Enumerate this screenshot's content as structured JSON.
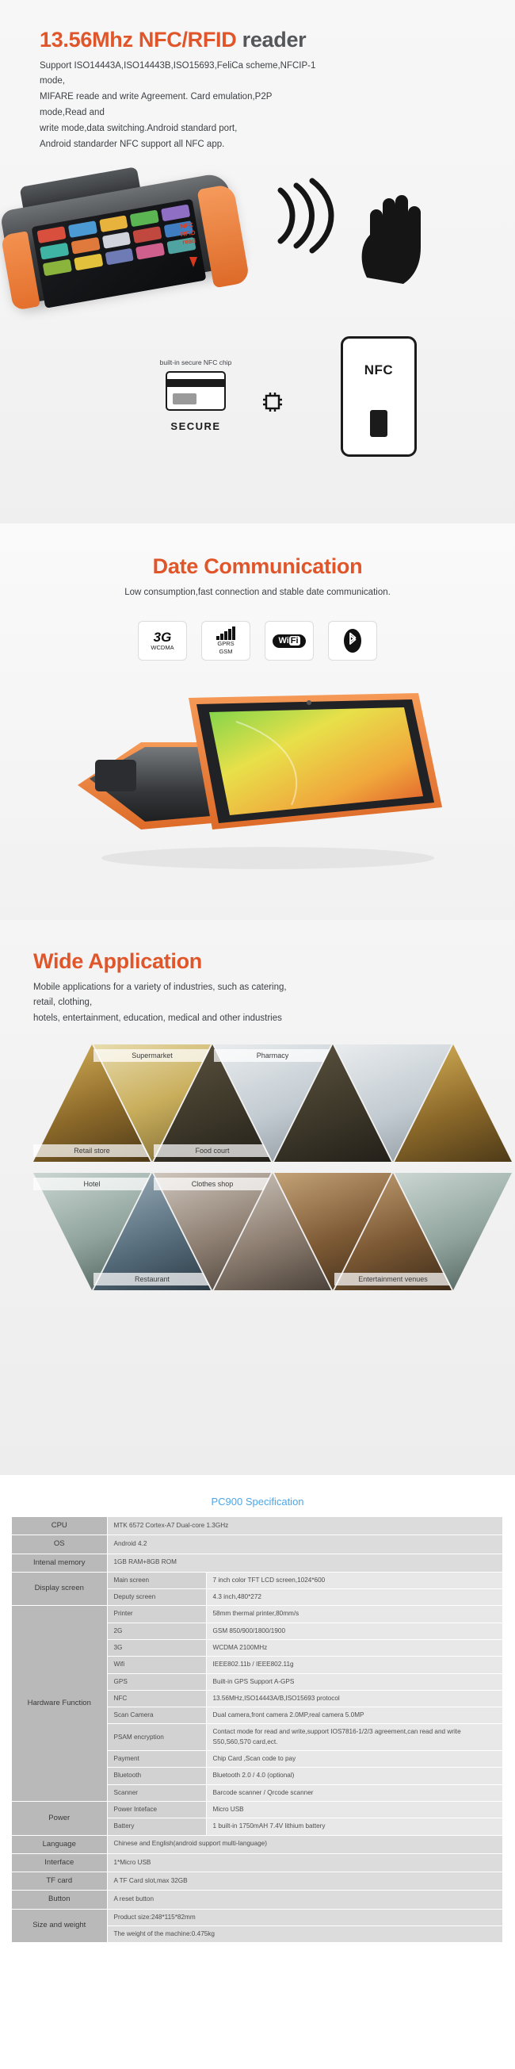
{
  "nfc_section": {
    "heading_accent": "13.56Mhz NFC/RFID",
    "heading_rest": " reader",
    "paragraph_lines": [
      "Support ISO14443A,ISO14443B,ISO15693,FeliCa scheme,NFCIP-1 mode,",
      "MIFARE reade and write Agreement. Card emulation,P2P mode,Read and",
      "write mode,data switching.Android standard port,",
      "Android standarder NFC support all NFC app."
    ],
    "device_tag": "NFC\nRFID\nread",
    "secure_caption": "built-in secure NFC chip",
    "secure_label": "SECURE",
    "phone_label": "NFC"
  },
  "dc_section": {
    "heading": "Date Communication",
    "subtitle": "Low consumption,fast connection and stable date communication.",
    "badges": [
      {
        "icon": "3g-icon",
        "glyph": "3G",
        "label_line1": "WCDMA",
        "label_line2": ""
      },
      {
        "icon": "signal-bars-icon",
        "glyph": "",
        "label_line1": "GPRS",
        "label_line2": "GSM"
      },
      {
        "icon": "wifi-icon",
        "glyph": "WiFi",
        "label_line1": "",
        "label_line2": ""
      },
      {
        "icon": "bluetooth-icon",
        "glyph": "",
        "label_line1": "",
        "label_line2": ""
      }
    ]
  },
  "wa_section": {
    "heading": "Wide Application",
    "subtitle_lines": [
      "Mobile applications for a variety of industries, such as catering, retail, clothing,",
      "hotels, entertainment, education, medical and other industries"
    ],
    "tiles": [
      {
        "label": "Supermarket",
        "dir": "down",
        "photo": "ph-super"
      },
      {
        "label": "Pharmacy",
        "dir": "down",
        "photo": "ph-pharm"
      },
      {
        "label": "Retail store",
        "dir": "up",
        "photo": "ph-retail"
      },
      {
        "label": "Food court",
        "dir": "up",
        "photo": "ph-food"
      },
      {
        "label": "Hotel",
        "dir": "down",
        "photo": "ph-hotel"
      },
      {
        "label": "Clothes shop",
        "dir": "down",
        "photo": "ph-clothes"
      },
      {
        "label": "Restaurant",
        "dir": "up",
        "photo": "ph-rest"
      },
      {
        "label": "Entertainment venues",
        "dir": "up",
        "photo": "ph-enter"
      }
    ]
  },
  "spec": {
    "title": "PC900 Specification",
    "rows": [
      {
        "c1": "CPU",
        "c2": "",
        "c3": "MTK 6572 Cortex-A7 Dual-core 1.3GHz",
        "span": "wide"
      },
      {
        "c1": "OS",
        "c2": "",
        "c3": "Android 4.2",
        "span": "wide"
      },
      {
        "c1": "Intenal memory",
        "c2": "",
        "c3": "1GB RAM+8GB ROM",
        "span": "wide"
      },
      {
        "c1": "Display screen",
        "c1_rowspan": 2,
        "c2": "Main screen",
        "c3": "7 inch color TFT LCD screen,1024*600"
      },
      {
        "c2": "Deputy screen",
        "c3": "4.3 inch,480*272"
      },
      {
        "c1": "Hardware Function",
        "c1_rowspan": 11,
        "c2": "Printer",
        "c3": "58mm thermal printer,80mm/s"
      },
      {
        "c2": "2G",
        "c3": "GSM 850/900/1800/1900"
      },
      {
        "c2": "3G",
        "c3": "WCDMA 2100MHz"
      },
      {
        "c2": "Wifi",
        "c3": "IEEE802.11b / IEEE802.11g"
      },
      {
        "c2": "GPS",
        "c3": "Built-in GPS Support A-GPS"
      },
      {
        "c2": "NFC",
        "c3": "13.56MHz,ISO14443A/B,ISO15693 protocol"
      },
      {
        "c2": "Scan Camera",
        "c3": "Dual camera,front camera 2.0MP,real camera 5.0MP"
      },
      {
        "c2": "PSAM encryption",
        "c3": "Contact mode for read and write,support IOS7816-1/2/3 agreement,can read and write S50,S60,S70 card,ect."
      },
      {
        "c2": "Payment",
        "c3": "Chip Card ,Scan code to pay"
      },
      {
        "c2": "Bluetooth",
        "c3": "Bluetooth 2.0 / 4.0 (optional)"
      },
      {
        "c2": "Scanner",
        "c3": "Barcode scanner / Qrcode scanner"
      },
      {
        "c1": "Power",
        "c1_rowspan": 2,
        "c2": "Power Inteface",
        "c3": "Micro USB"
      },
      {
        "c2": "Battery",
        "c3": "1 built-in 1750mAH 7.4V lithium battery"
      },
      {
        "c1": "Language",
        "c2": "",
        "c3": "Chinese and English(android support multi-language)",
        "span": "wide"
      },
      {
        "c1": "Interface",
        "c2": "",
        "c3": "1*Micro USB",
        "span": "wide"
      },
      {
        "c1": "TF card",
        "c2": "",
        "c3": "A TF Card slot,max 32GB",
        "span": "wide"
      },
      {
        "c1": "Button",
        "c2": "",
        "c3": "A reset button",
        "span": "wide"
      },
      {
        "c1": "Size and weight",
        "c1_rowspan": 2,
        "c2": "",
        "c3": "Product size:248*115*82mm",
        "span2": "wide"
      },
      {
        "c2": "",
        "c3": "The weight of the machine:0.475kg",
        "span2": "wide"
      }
    ]
  },
  "colors": {
    "accent_orange": "#e0562a",
    "spec_title_blue": "#4da6e8",
    "header_grey": "#b9b9b9",
    "cell_grey": "#d2d2d2",
    "value_grey": "#e8e8e8"
  }
}
